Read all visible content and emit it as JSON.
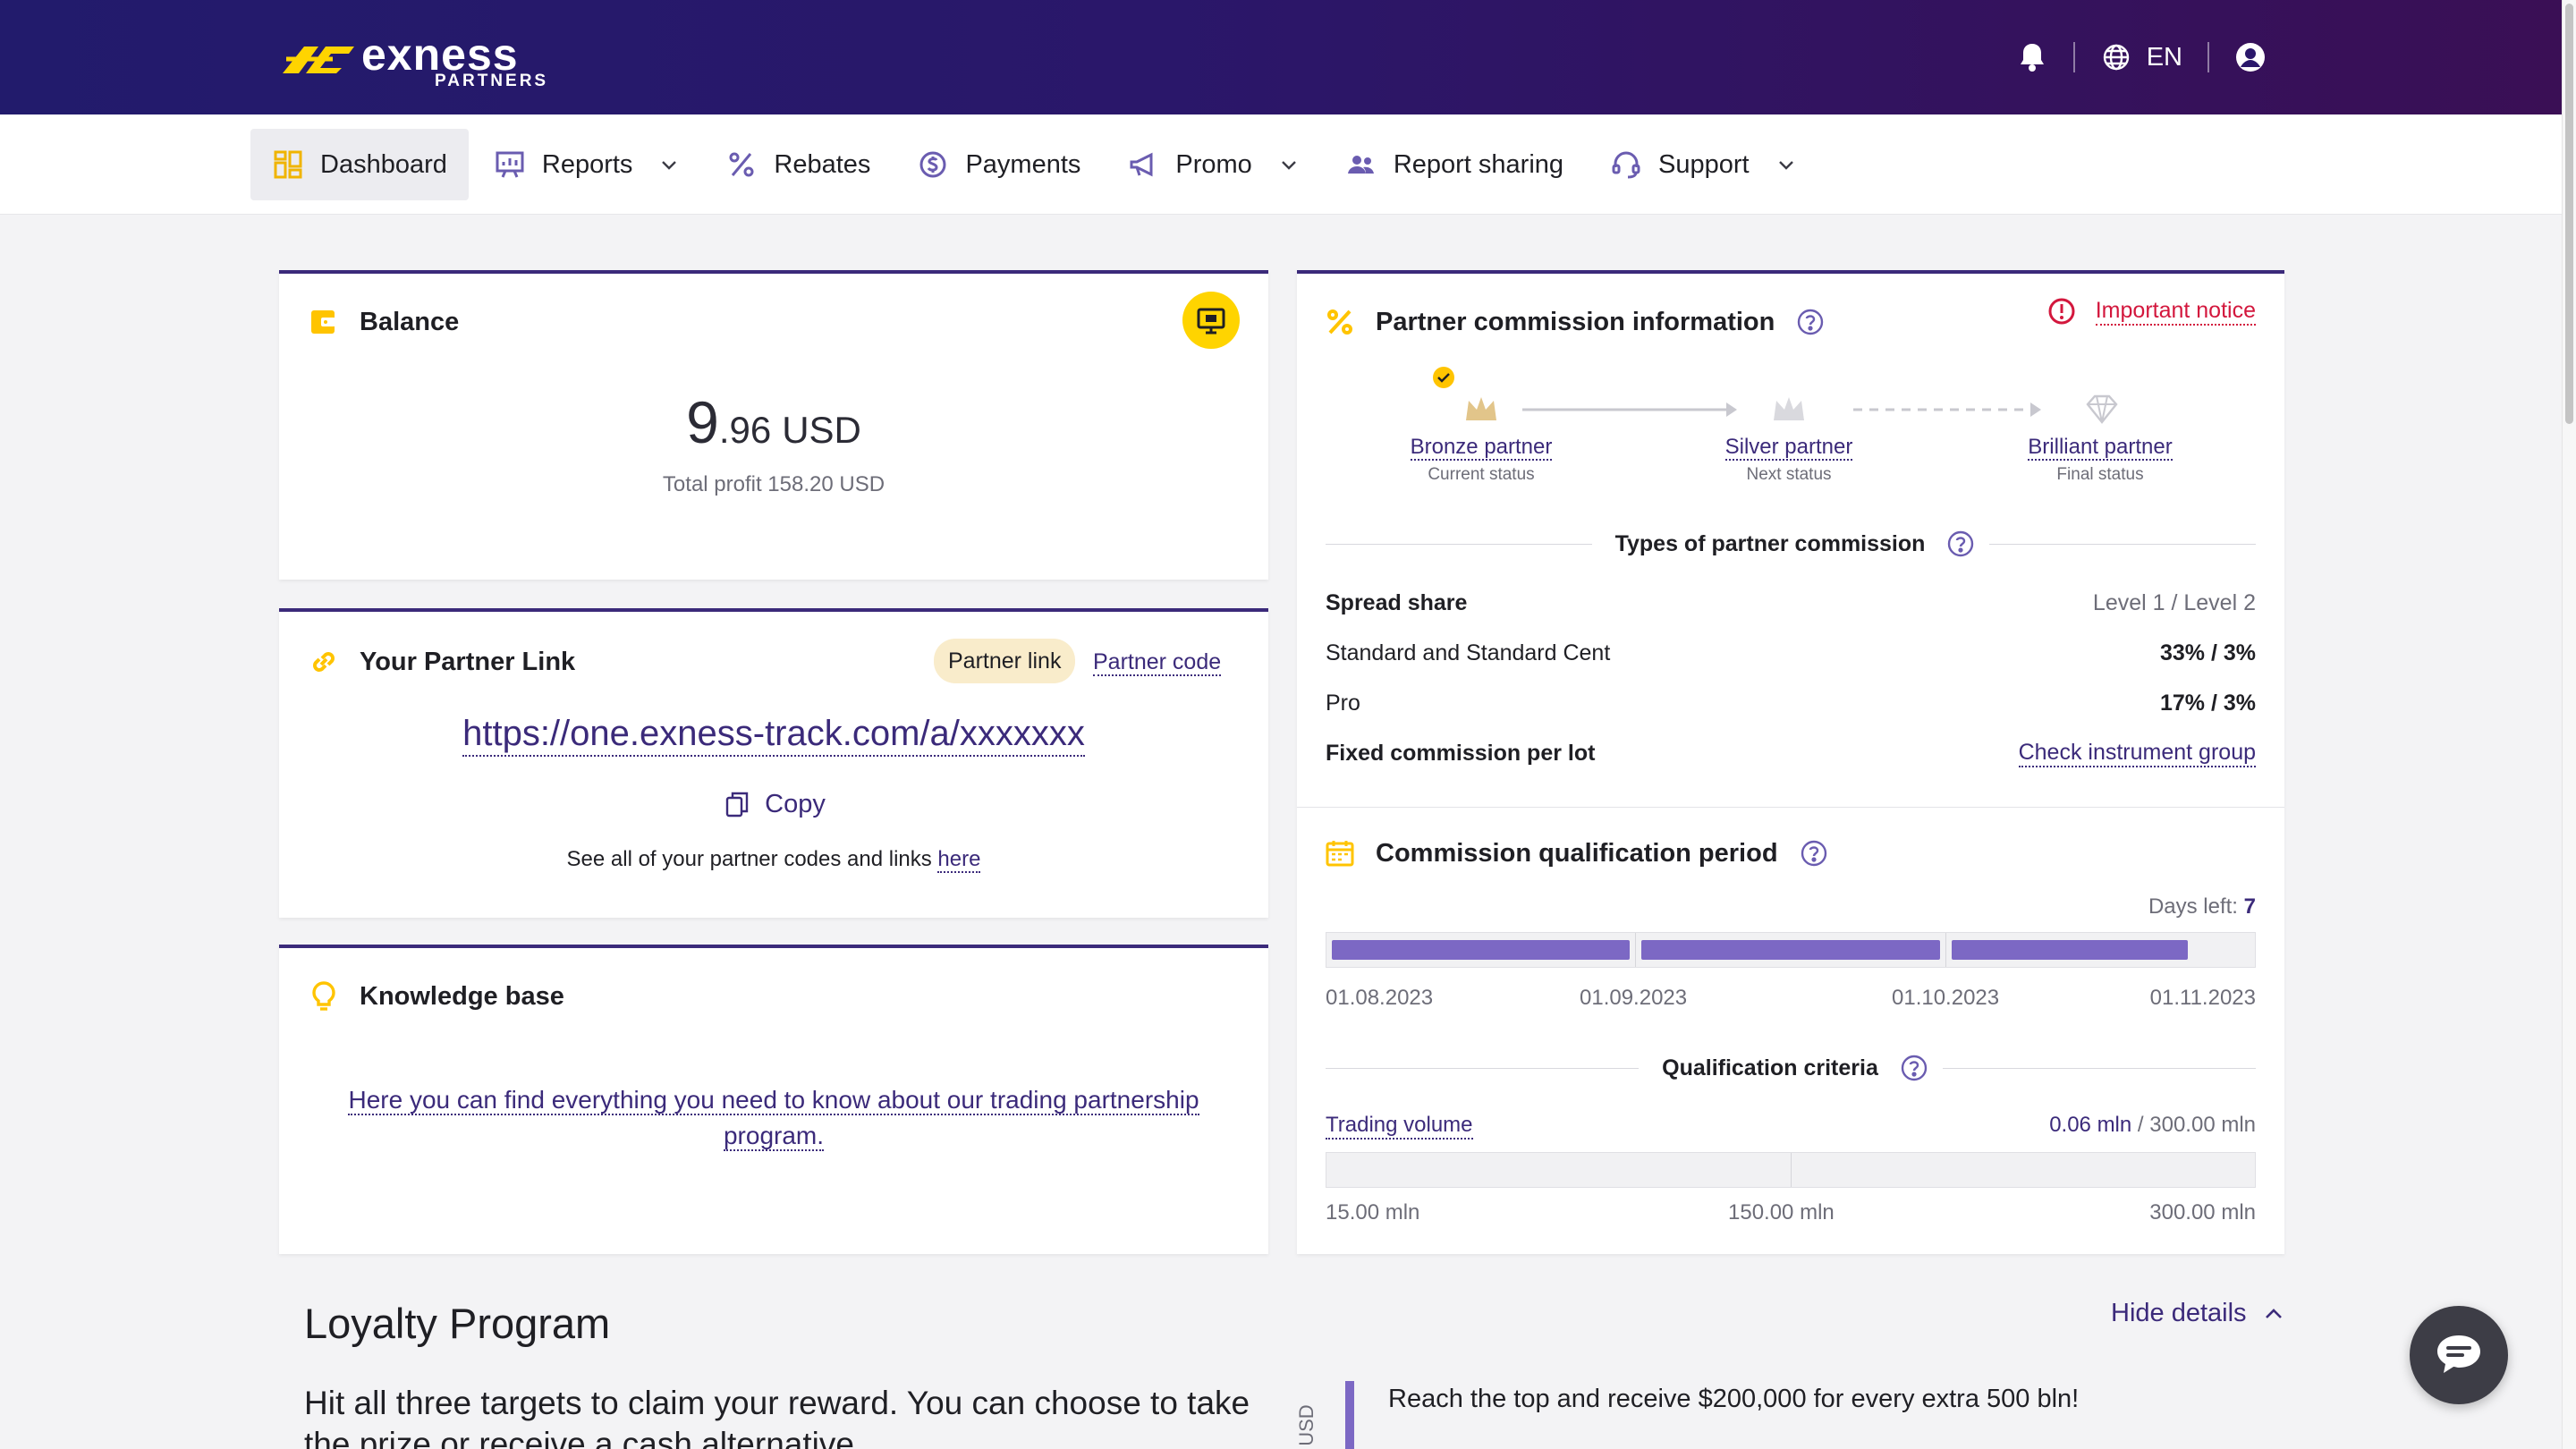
{
  "header": {
    "brand": "exness",
    "brand_sub": "PARTNERS",
    "language": "EN",
    "icons": [
      "bell-icon",
      "globe-icon",
      "user-circle-icon"
    ]
  },
  "nav": {
    "items": [
      {
        "label": "Dashboard",
        "icon": "dashboard-icon",
        "dropdown": false,
        "active": true
      },
      {
        "label": "Reports",
        "icon": "chart-board-icon",
        "dropdown": true,
        "active": false
      },
      {
        "label": "Rebates",
        "icon": "percent-icon",
        "dropdown": false,
        "active": false
      },
      {
        "label": "Payments",
        "icon": "dollar-circle-icon",
        "dropdown": false,
        "active": false
      },
      {
        "label": "Promo",
        "icon": "megaphone-icon",
        "dropdown": true,
        "active": false
      },
      {
        "label": "Report sharing",
        "icon": "users-icon",
        "dropdown": false,
        "active": false
      },
      {
        "label": "Support",
        "icon": "headset-icon",
        "dropdown": true,
        "active": false
      }
    ]
  },
  "balance": {
    "title": "Balance",
    "amount_int": "9",
    "amount_dec": ".96",
    "currency": "USD",
    "total_profit": "Total profit 158.20 USD"
  },
  "partner_link": {
    "title": "Your Partner Link",
    "tab_link": "Partner link",
    "tab_code": "Partner code",
    "url": "https://one.exness-track.com/a/xxxxxxx",
    "copy_label": "Copy",
    "see_all_text": "See all of your partner codes and links ",
    "see_all_link": "here"
  },
  "knowledge_base": {
    "title": "Knowledge base",
    "text": "Here you can find everything you need to know about our trading partnership program."
  },
  "commission": {
    "title": "Partner commission information",
    "notice": "Important notice",
    "statuses": [
      {
        "name": "Bronze partner",
        "sub": "Current status"
      },
      {
        "name": "Silver partner",
        "sub": "Next status"
      },
      {
        "name": "Brilliant partner",
        "sub": "Final status"
      }
    ],
    "types_title": "Types of partner commission",
    "rows": [
      {
        "label": "Spread share",
        "value": "Level 1 / Level 2"
      },
      {
        "label": "Standard and Standard Cent",
        "value": "33% / 3%"
      },
      {
        "label": "Pro",
        "value": "17% / 3%"
      },
      {
        "label": "Fixed commission per lot",
        "value": "Check instrument group"
      }
    ]
  },
  "qualification": {
    "title": "Commission qualification period",
    "days_left_label": "Days left: ",
    "days_left_value": "7",
    "period_progress": [
      1.0,
      1.0,
      0.8
    ],
    "dates": [
      "01.08.2023",
      "01.09.2023",
      "01.10.2023",
      "01.11.2023"
    ],
    "criteria_title": "Qualification criteria",
    "trading_volume_label": "Trading volume",
    "trading_volume_value": "0.06 mln",
    "trading_volume_target": " / 300.00 mln",
    "volume_ticks": [
      "15.00 mln",
      "150.00 mln",
      "300.00 mln"
    ]
  },
  "loyalty": {
    "title": "Loyalty Program",
    "hide_details": "Hide details",
    "text": "Hit all three targets to claim your reward. You can choose to take the prize or receive a cash alternative.",
    "axis_label": "in USD",
    "reach_text": "Reach the top and receive $200,000 for every extra 500 bln!"
  },
  "colors": {
    "header_start": "#221b6c",
    "header_end": "#3a0f55",
    "accent": "#3b2a7a",
    "progress": "#7c68c4",
    "yellow": "#ffd400",
    "danger": "#d3173d"
  }
}
